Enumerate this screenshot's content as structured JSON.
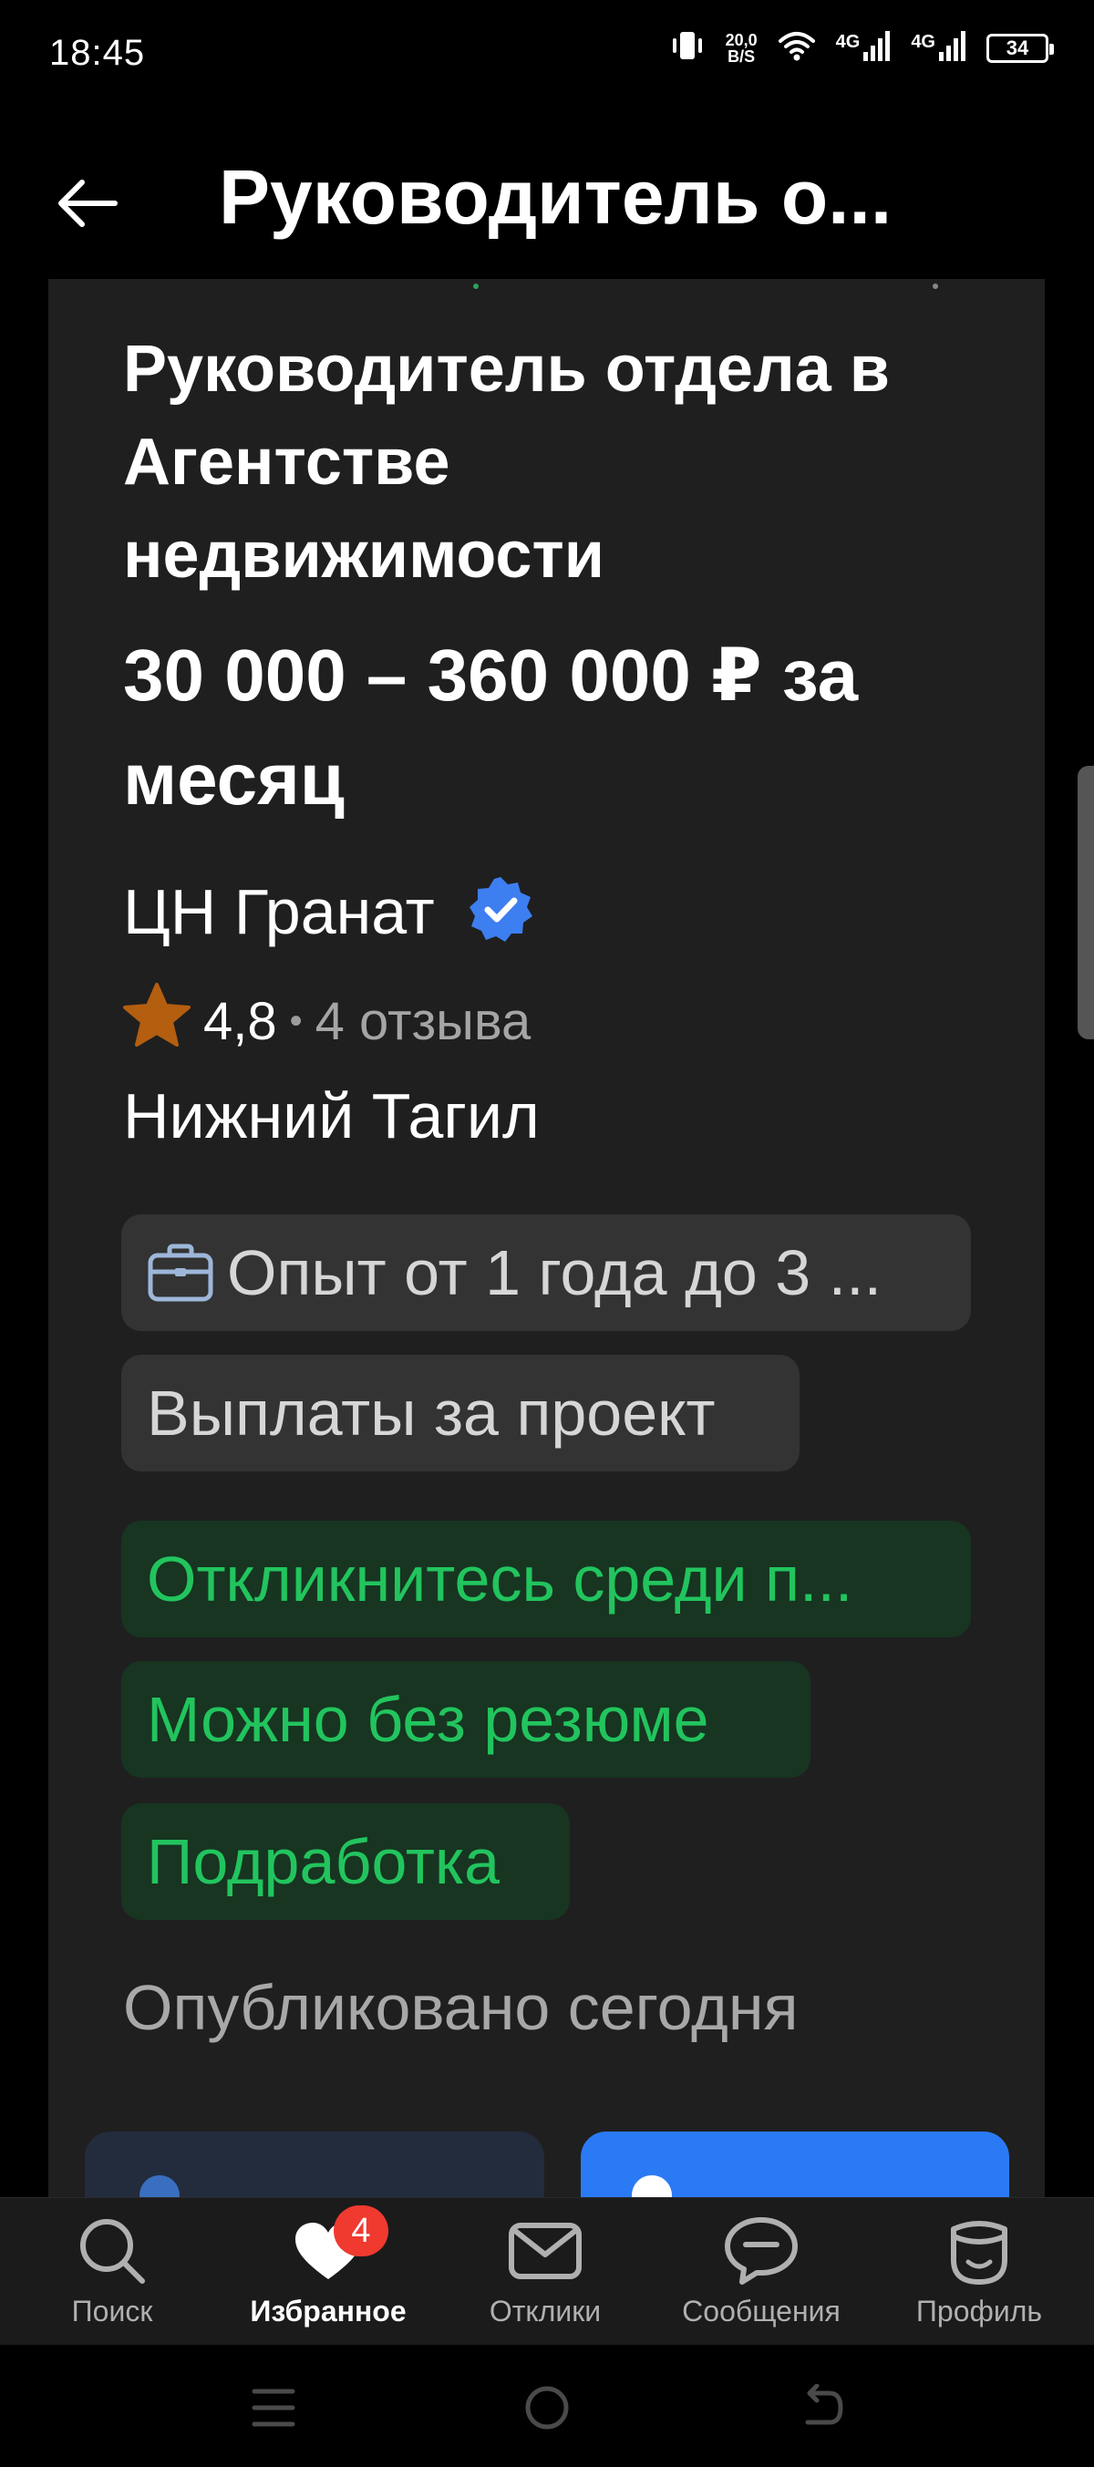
{
  "status_bar": {
    "time": "18:45",
    "speed_value": "20,0",
    "speed_unit": "B/S",
    "network1": "4G",
    "network2": "4G",
    "battery": "34"
  },
  "header": {
    "title": "Руководитель о..."
  },
  "vacancy": {
    "title": "Руководитель отдела в Агентстве недвижимости",
    "salary": "30 000 – 360 000 ₽ за месяц",
    "company": "ЦН Гранат",
    "rating": "4,8",
    "reviews": "4 отзыва",
    "city": "Нижний Тагил",
    "experience": "Опыт от 1 года до 3 ...",
    "payout": "Выплаты за проект",
    "respond_among": "Откликнитесь среди п...",
    "no_resume": "Можно без резюме",
    "part_time": "Подработка",
    "published": "Опубликовано сегодня"
  },
  "colors": {
    "background": "#000000",
    "card": "#1f1f1f",
    "chip_gray": "#333333",
    "chip_green_bg": "#173521",
    "chip_green_text": "#22c45e",
    "verified": "#3d7ef0",
    "star": "#b45e10",
    "primary_button": "#2b7af5",
    "badge": "#f03a30"
  },
  "icons": {
    "back": "arrow-left-icon",
    "verified": "verified-badge-icon",
    "star": "star-icon",
    "experience": "briefcase-icon"
  },
  "bottom_nav": {
    "items": [
      {
        "label": "Поиск",
        "icon": "search-icon"
      },
      {
        "label": "Избранное",
        "icon": "heart-icon",
        "badge": "4"
      },
      {
        "label": "Отклики",
        "icon": "mail-icon"
      },
      {
        "label": "Сообщения",
        "icon": "chat-icon"
      },
      {
        "label": "Профиль",
        "icon": "profile-icon"
      }
    ]
  }
}
